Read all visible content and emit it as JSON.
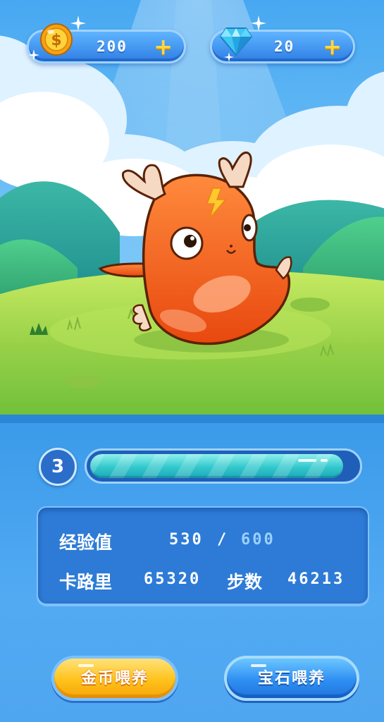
{
  "currency": {
    "coins": {
      "value": "200",
      "icon": "gold-coin-icon",
      "plus": "+"
    },
    "gems": {
      "value": "20",
      "icon": "blue-diamond-icon",
      "plus": "+"
    }
  },
  "pet": {
    "image": "orange-dragon-pet-illustration"
  },
  "level": {
    "number": "3",
    "progress_fraction": 0.95
  },
  "stats": {
    "exp_label": "经验值",
    "exp_current": "530",
    "exp_separator": "/",
    "exp_max": "600",
    "calories_label": "卡路里",
    "calories_value": "65320",
    "steps_label": "步数",
    "steps_value": "46213"
  },
  "buttons": {
    "coin_feed": "金币喂养",
    "gem_feed": "宝石喂养"
  },
  "colors": {
    "sky": "#6bbcf7",
    "grass": "#a8d94a",
    "pet": "#f4681c",
    "panel": "#4aa2ea",
    "coin_button": "#ffc21a",
    "gem_button": "#2f8ff2"
  }
}
